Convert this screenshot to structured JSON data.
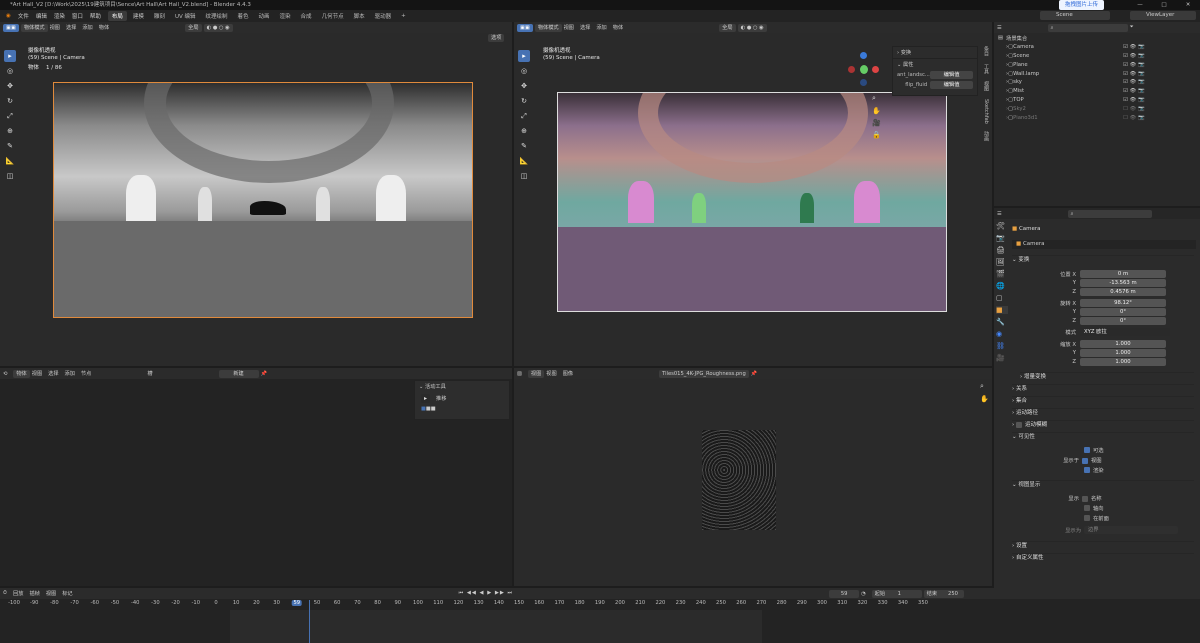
{
  "window": {
    "title": "*Art Hall_V2 [D:\\Work\\2025\\19建筑项目\\Sence\\Art Hall\\Art Hall_V2.blend] - Blender 4.4.3",
    "upload_label": "拖拽图片上传",
    "controls": [
      "—",
      "□",
      "✕"
    ]
  },
  "menubar": {
    "menus": [
      "文件",
      "编辑",
      "渲染",
      "窗口",
      "帮助"
    ],
    "workspaces": [
      "布局",
      "建模",
      "雕刻",
      "UV 编辑",
      "纹理绘制",
      "着色",
      "动画",
      "渲染",
      "合成",
      "几何节点",
      "脚本",
      "驱动器"
    ],
    "active_workspace": "布局",
    "add_tab": "+",
    "scene": "Scene",
    "view_layer": "ViewLayer"
  },
  "viewport_left": {
    "header": [
      "物体模式",
      "视图",
      "选择",
      "添加",
      "物体"
    ],
    "transform": "全局",
    "options": "选项",
    "info_title": "摄像机透视",
    "info_scene": "(59) Scene | Camera",
    "info_objects_label": "物体",
    "info_objects": "1 / 86"
  },
  "viewport_right": {
    "header": [
      "物体模式",
      "视图",
      "选择",
      "添加",
      "物体"
    ],
    "transform": "全局",
    "options": "选项",
    "info_title": "摄像机透视",
    "info_scene": "(59) Scene | Camera",
    "npanel": {
      "transform": "变换",
      "properties": "属性",
      "rows": [
        {
          "label": "ant_landsc...",
          "button": "编辑值"
        },
        {
          "label": "flip_fluid",
          "button": "编辑值"
        }
      ]
    },
    "side_tabs": [
      "条目",
      "工具",
      "视图",
      "Sketchfab",
      "动画"
    ]
  },
  "outliner": {
    "title": "场景集合",
    "items": [
      {
        "name": "Camera",
        "dim": false
      },
      {
        "name": "Scene",
        "dim": false
      },
      {
        "name": "Plane",
        "dim": false
      },
      {
        "name": "Wall.lamp",
        "dim": false
      },
      {
        "name": "sky",
        "dim": false
      },
      {
        "name": "Mist",
        "dim": false
      },
      {
        "name": "TOP",
        "dim": false
      },
      {
        "name": "Sky2",
        "dim": true
      },
      {
        "name": "Piano3d1",
        "dim": true
      }
    ]
  },
  "properties": {
    "object_name": "Camera",
    "datablock": "Camera",
    "transform_header": "变换",
    "location_label": "位置 X",
    "location": [
      "0 m",
      "-13.563 m",
      "0.4576 m"
    ],
    "rotation_label": "旋转 X",
    "rotation": [
      "98.12°",
      "0°",
      "0°"
    ],
    "mode_label": "模式",
    "mode_value": "XYZ 欧拉",
    "scale_label": "缩放 X",
    "scale": [
      "1.000",
      "1.000",
      "1.000"
    ],
    "axis_y": "Y",
    "axis_z": "Z",
    "delta_transform": "增量变换",
    "sections": [
      "关系",
      "集合",
      "运动路径",
      "运动模糊",
      "可见性"
    ],
    "visibility": {
      "selectable": "可选",
      "show_in": "显示于",
      "viewport": "视图",
      "render": "渲染"
    },
    "viewport_display": "视图显示",
    "display": {
      "show": "显示",
      "name": "名称",
      "axes": "轴向",
      "in_front": "在前面",
      "display_as": "显示为",
      "display_as_value": "边界"
    },
    "footer_sections": [
      "设置",
      "自定义属性"
    ]
  },
  "node_editor": {
    "header": [
      "物体",
      "视图",
      "选择",
      "添加",
      "节点"
    ],
    "slot": "槽",
    "new_button": "新建",
    "active_tool": "活动工具",
    "tweak": "推移"
  },
  "image_editor": {
    "header": [
      "视图",
      "视图",
      "图像"
    ],
    "image_name": "Tiles015_4K-JPG_Roughness.png"
  },
  "timeline": {
    "menu": [
      "回放",
      "插帧",
      "视图",
      "标记"
    ],
    "current_frame": "59",
    "start_label": "起始",
    "start": "1",
    "end_label": "结束",
    "end": "250",
    "ticks": [
      "-100",
      "-90",
      "-80",
      "-70",
      "-60",
      "-50",
      "-40",
      "-30",
      "-20",
      "-10",
      "0",
      "10",
      "20",
      "30",
      "59",
      "50",
      "60",
      "70",
      "80",
      "90",
      "100",
      "110",
      "120",
      "130",
      "140",
      "150",
      "160",
      "170",
      "180",
      "190",
      "200",
      "210",
      "220",
      "230",
      "240",
      "250",
      "260",
      "270",
      "280",
      "290",
      "300",
      "310",
      "320",
      "330",
      "340",
      "350"
    ]
  },
  "colors": {
    "accent": "#4772b3",
    "panel": "#303030",
    "header": "#2b2b2b",
    "camera_frame": "#e08a3c"
  }
}
